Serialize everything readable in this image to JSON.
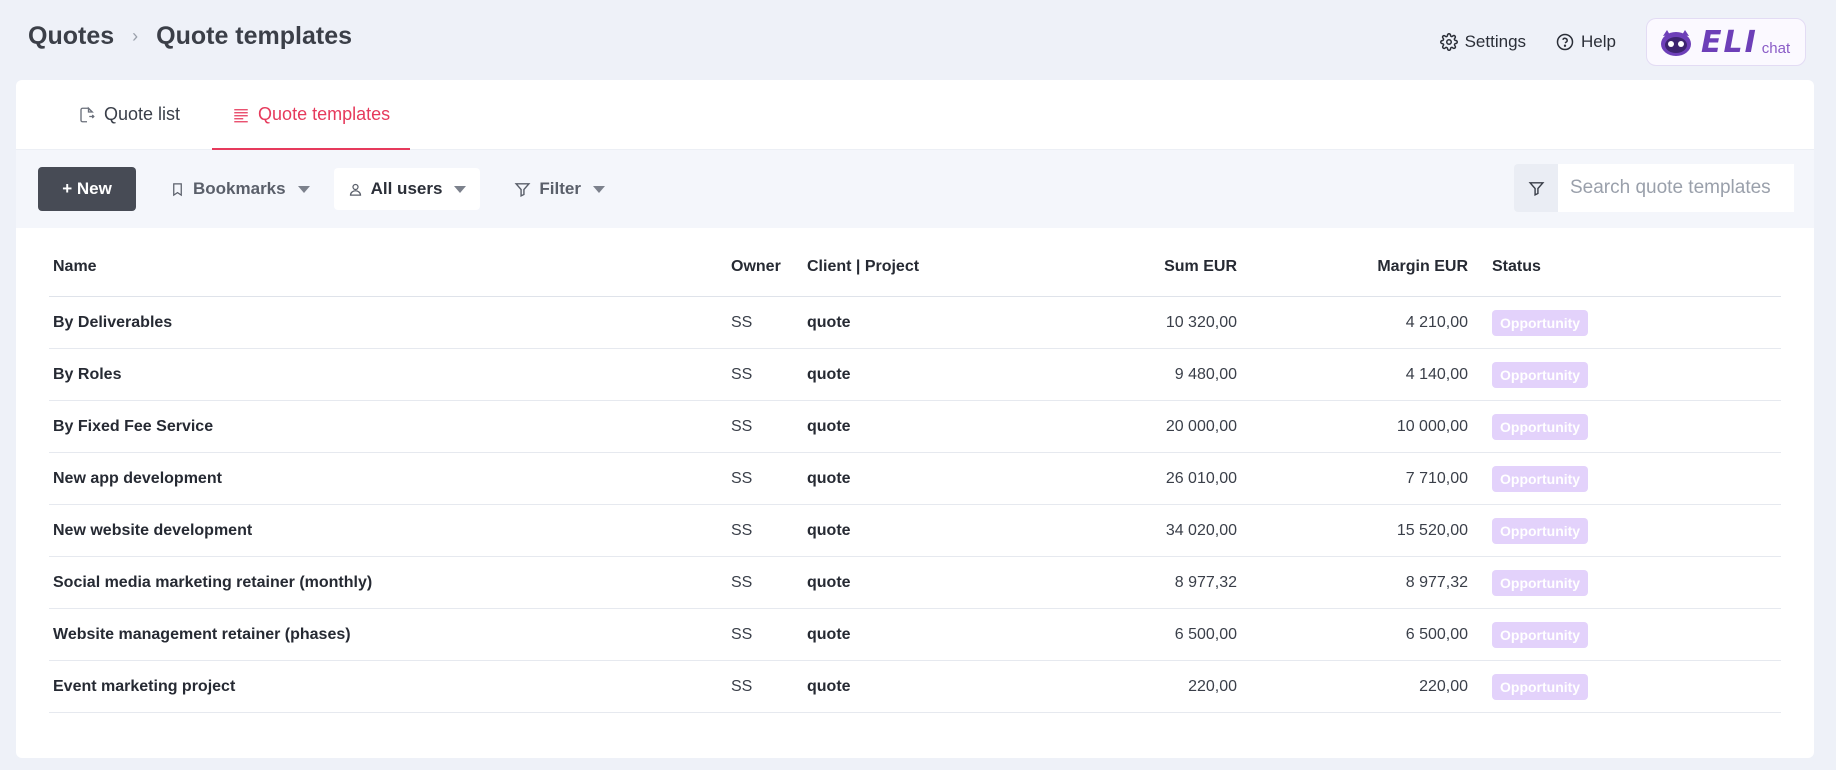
{
  "breadcrumb": {
    "root": "Quotes",
    "current": "Quote templates"
  },
  "header": {
    "settings_label": "Settings",
    "help_label": "Help",
    "logo_text": "ELI",
    "logo_suffix": "chat"
  },
  "tabs": [
    {
      "label": "Quote list",
      "icon": "quote-list-icon",
      "active": false
    },
    {
      "label": "Quote templates",
      "icon": "templates-list-icon",
      "active": true
    }
  ],
  "toolbar": {
    "new_label": "+ New",
    "bookmarks_label": "Bookmarks",
    "users_label": "All users",
    "filter_label": "Filter",
    "search_placeholder": "Search quote templates"
  },
  "table": {
    "headers": {
      "name": "Name",
      "owner": "Owner",
      "client": "Client | Project",
      "sum": "Sum EUR",
      "margin": "Margin  EUR",
      "status": "Status"
    },
    "rows": [
      {
        "name": "By Deliverables",
        "owner": "SS",
        "client": "quote",
        "sum": "10 320,00",
        "margin": "4 210,00",
        "status": "Opportunity"
      },
      {
        "name": "By Roles",
        "owner": "SS",
        "client": "quote",
        "sum": "9 480,00",
        "margin": "4 140,00",
        "status": "Opportunity"
      },
      {
        "name": "By Fixed Fee Service",
        "owner": "SS",
        "client": "quote",
        "sum": "20 000,00",
        "margin": "10 000,00",
        "status": "Opportunity"
      },
      {
        "name": "New app development",
        "owner": "SS",
        "client": "quote",
        "sum": "26 010,00",
        "margin": "7 710,00",
        "status": "Opportunity"
      },
      {
        "name": "New website development",
        "owner": "SS",
        "client": "quote",
        "sum": "34 020,00",
        "margin": "15 520,00",
        "status": "Opportunity"
      },
      {
        "name": "Social media marketing retainer (monthly)",
        "owner": "SS",
        "client": "quote",
        "sum": "8 977,32",
        "margin": "8 977,32",
        "status": "Opportunity"
      },
      {
        "name": "Website management retainer (phases)",
        "owner": "SS",
        "client": "quote",
        "sum": "6 500,00",
        "margin": "6 500,00",
        "status": "Opportunity"
      },
      {
        "name": "Event marketing project",
        "owner": "SS",
        "client": "quote",
        "sum": "220,00",
        "margin": "220,00",
        "status": "Opportunity"
      }
    ]
  },
  "colors": {
    "accent": "#e63a5c",
    "new_button": "#474b55",
    "badge": "#e3d2fb",
    "brand": "#6d3fb8"
  }
}
